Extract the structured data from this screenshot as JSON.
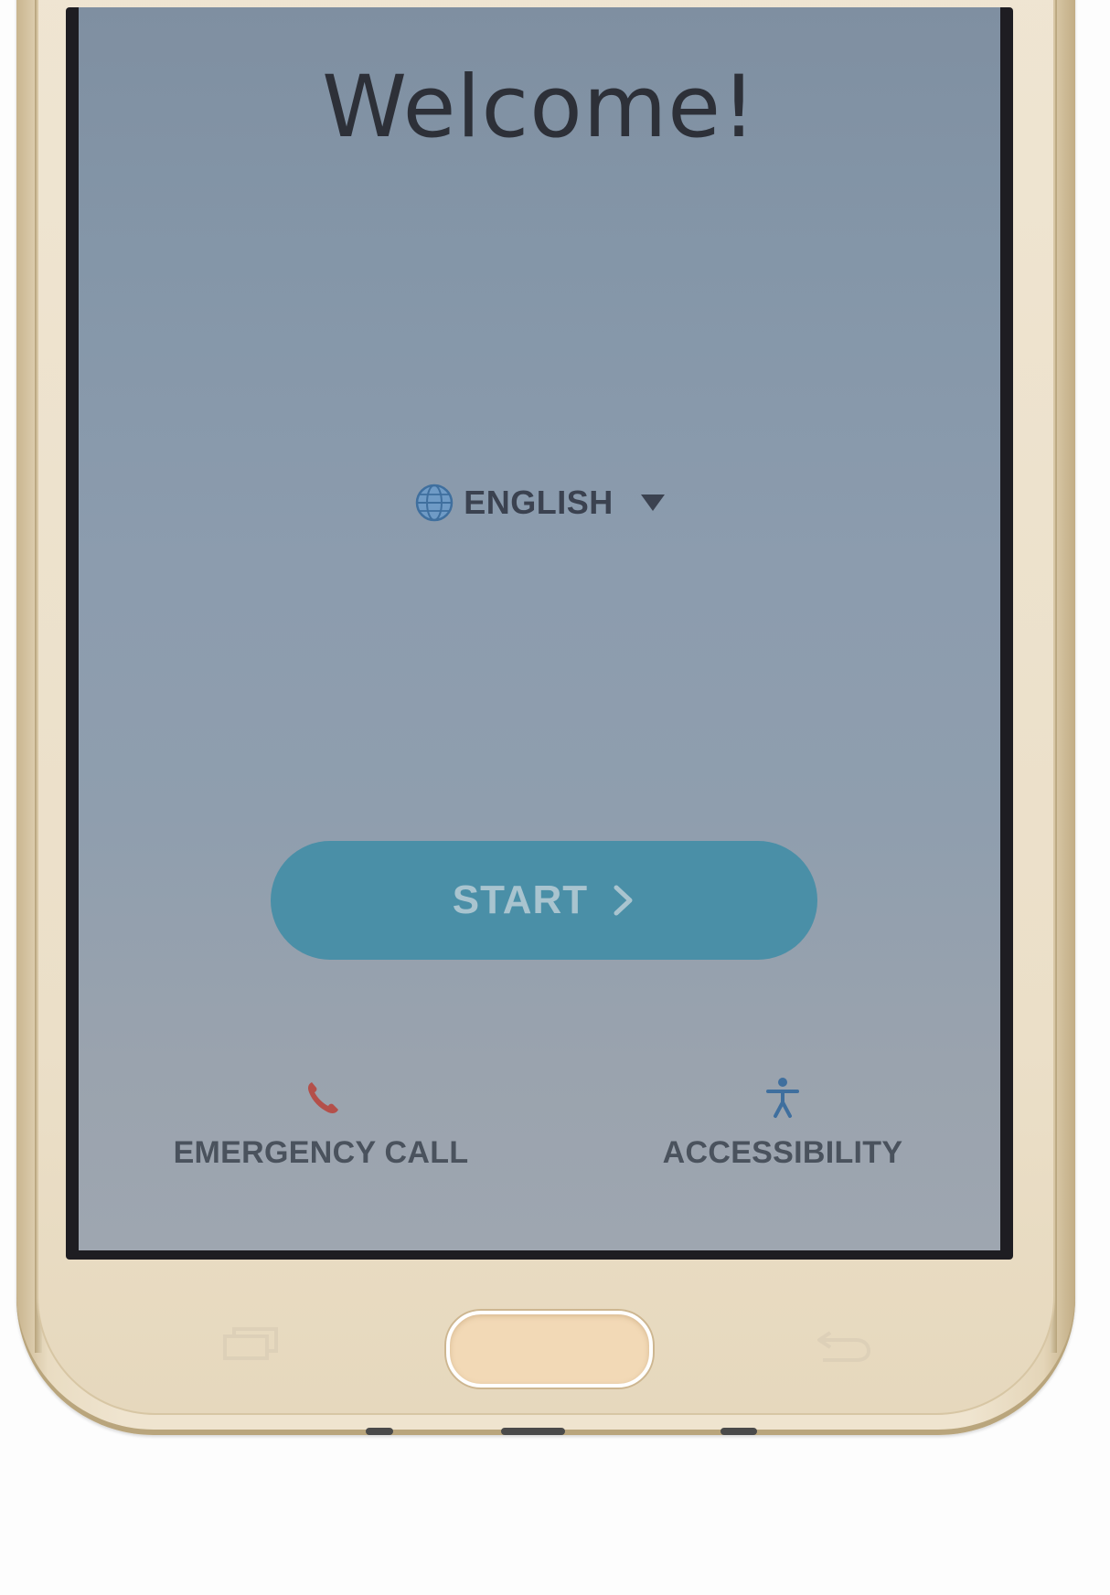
{
  "welcome": {
    "title": "Welcome!"
  },
  "language": {
    "label": "ENGLISH",
    "icon": "globe-icon",
    "accent": "#3f6f9e"
  },
  "start": {
    "label": "START",
    "icon": "chevron-right-icon",
    "color": "#4a8fa7"
  },
  "bottom": {
    "emergency": {
      "label": "EMERGENCY CALL",
      "icon": "phone-icon",
      "color": "#b4504a"
    },
    "accessibility": {
      "label": "ACCESSIBILITY",
      "icon": "accessibility-icon",
      "color": "#3f6f9e"
    }
  },
  "keys": {
    "home": "home-key",
    "recent": "recent-apps-key",
    "back": "back-key"
  }
}
